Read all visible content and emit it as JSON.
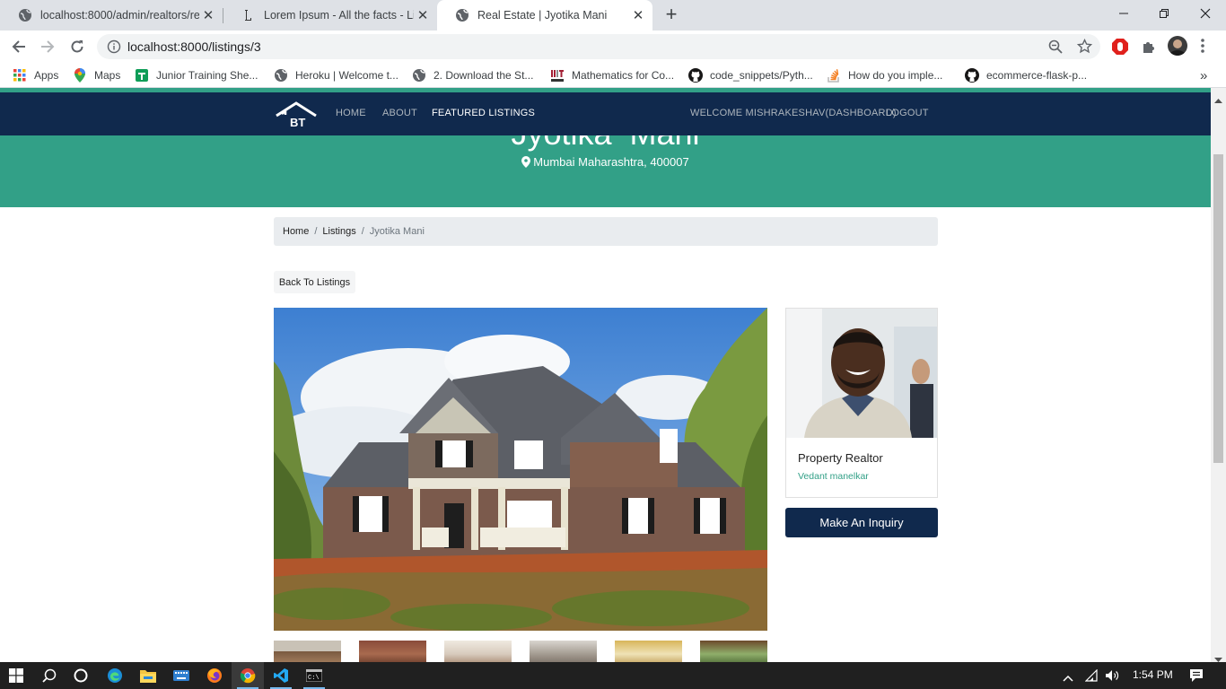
{
  "browser": {
    "tabs": [
      {
        "title": "localhost:8000/admin/realtors/re",
        "close": "✕"
      },
      {
        "title": "Lorem Ipsum - All the facts - Lipsum",
        "close": "✕"
      },
      {
        "title": "Real Estate | Jyotika  Mani",
        "close": "✕"
      }
    ],
    "new_tab": "+",
    "url": "localhost:8000/listings/3",
    "bookmarks": [
      {
        "label": "Apps",
        "icon": "apps-grid-icon"
      },
      {
        "label": "Maps",
        "icon": "maps-pin-icon"
      },
      {
        "label": "Junior Training She...",
        "icon": "sheets-icon"
      },
      {
        "label": "Heroku | Welcome t...",
        "icon": "globe-icon"
      },
      {
        "label": "2. Download the St...",
        "icon": "globe-icon"
      },
      {
        "label": "Mathematics for Co...",
        "icon": "mit-ocw-icon"
      },
      {
        "label": "code_snippets/Pyth...",
        "icon": "github-icon"
      },
      {
        "label": "How do you imple...",
        "icon": "stackoverflow-icon"
      },
      {
        "label": "ecommerce-flask-p...",
        "icon": "github-icon"
      }
    ],
    "bookmarks_more": "»"
  },
  "site": {
    "logo_text": "BT",
    "nav": {
      "home": "HOME",
      "about": "ABOUT",
      "featured": "FEATURED LISTINGS",
      "welcome": "WELCOME MISHRAKESHAV(DASHBOARD)",
      "logout": "LOGOUT"
    },
    "hero": {
      "title": "Jyotika  Mani",
      "location": "Mumbai Maharashtra, 400007"
    },
    "breadcrumb": {
      "home": "Home",
      "sep": "/",
      "listings": "Listings",
      "current": "Jyotika  Mani"
    },
    "back_button": "Back To Listings",
    "realtor": {
      "title": "Property Realtor",
      "name": "Vedant manelkar"
    },
    "inquiry_button": "Make An Inquiry"
  },
  "taskbar": {
    "time": "1:54 PM",
    "apps": [
      "windows-start-icon",
      "search-icon",
      "cortana-icon",
      "edge-icon",
      "file-explorer-icon",
      "keyboard-app-icon",
      "firefox-icon",
      "chrome-icon",
      "vscode-icon",
      "terminal-icon"
    ]
  },
  "colors": {
    "navbar": "#10294d",
    "showcase": "#32a087",
    "accent": "#32a087"
  }
}
